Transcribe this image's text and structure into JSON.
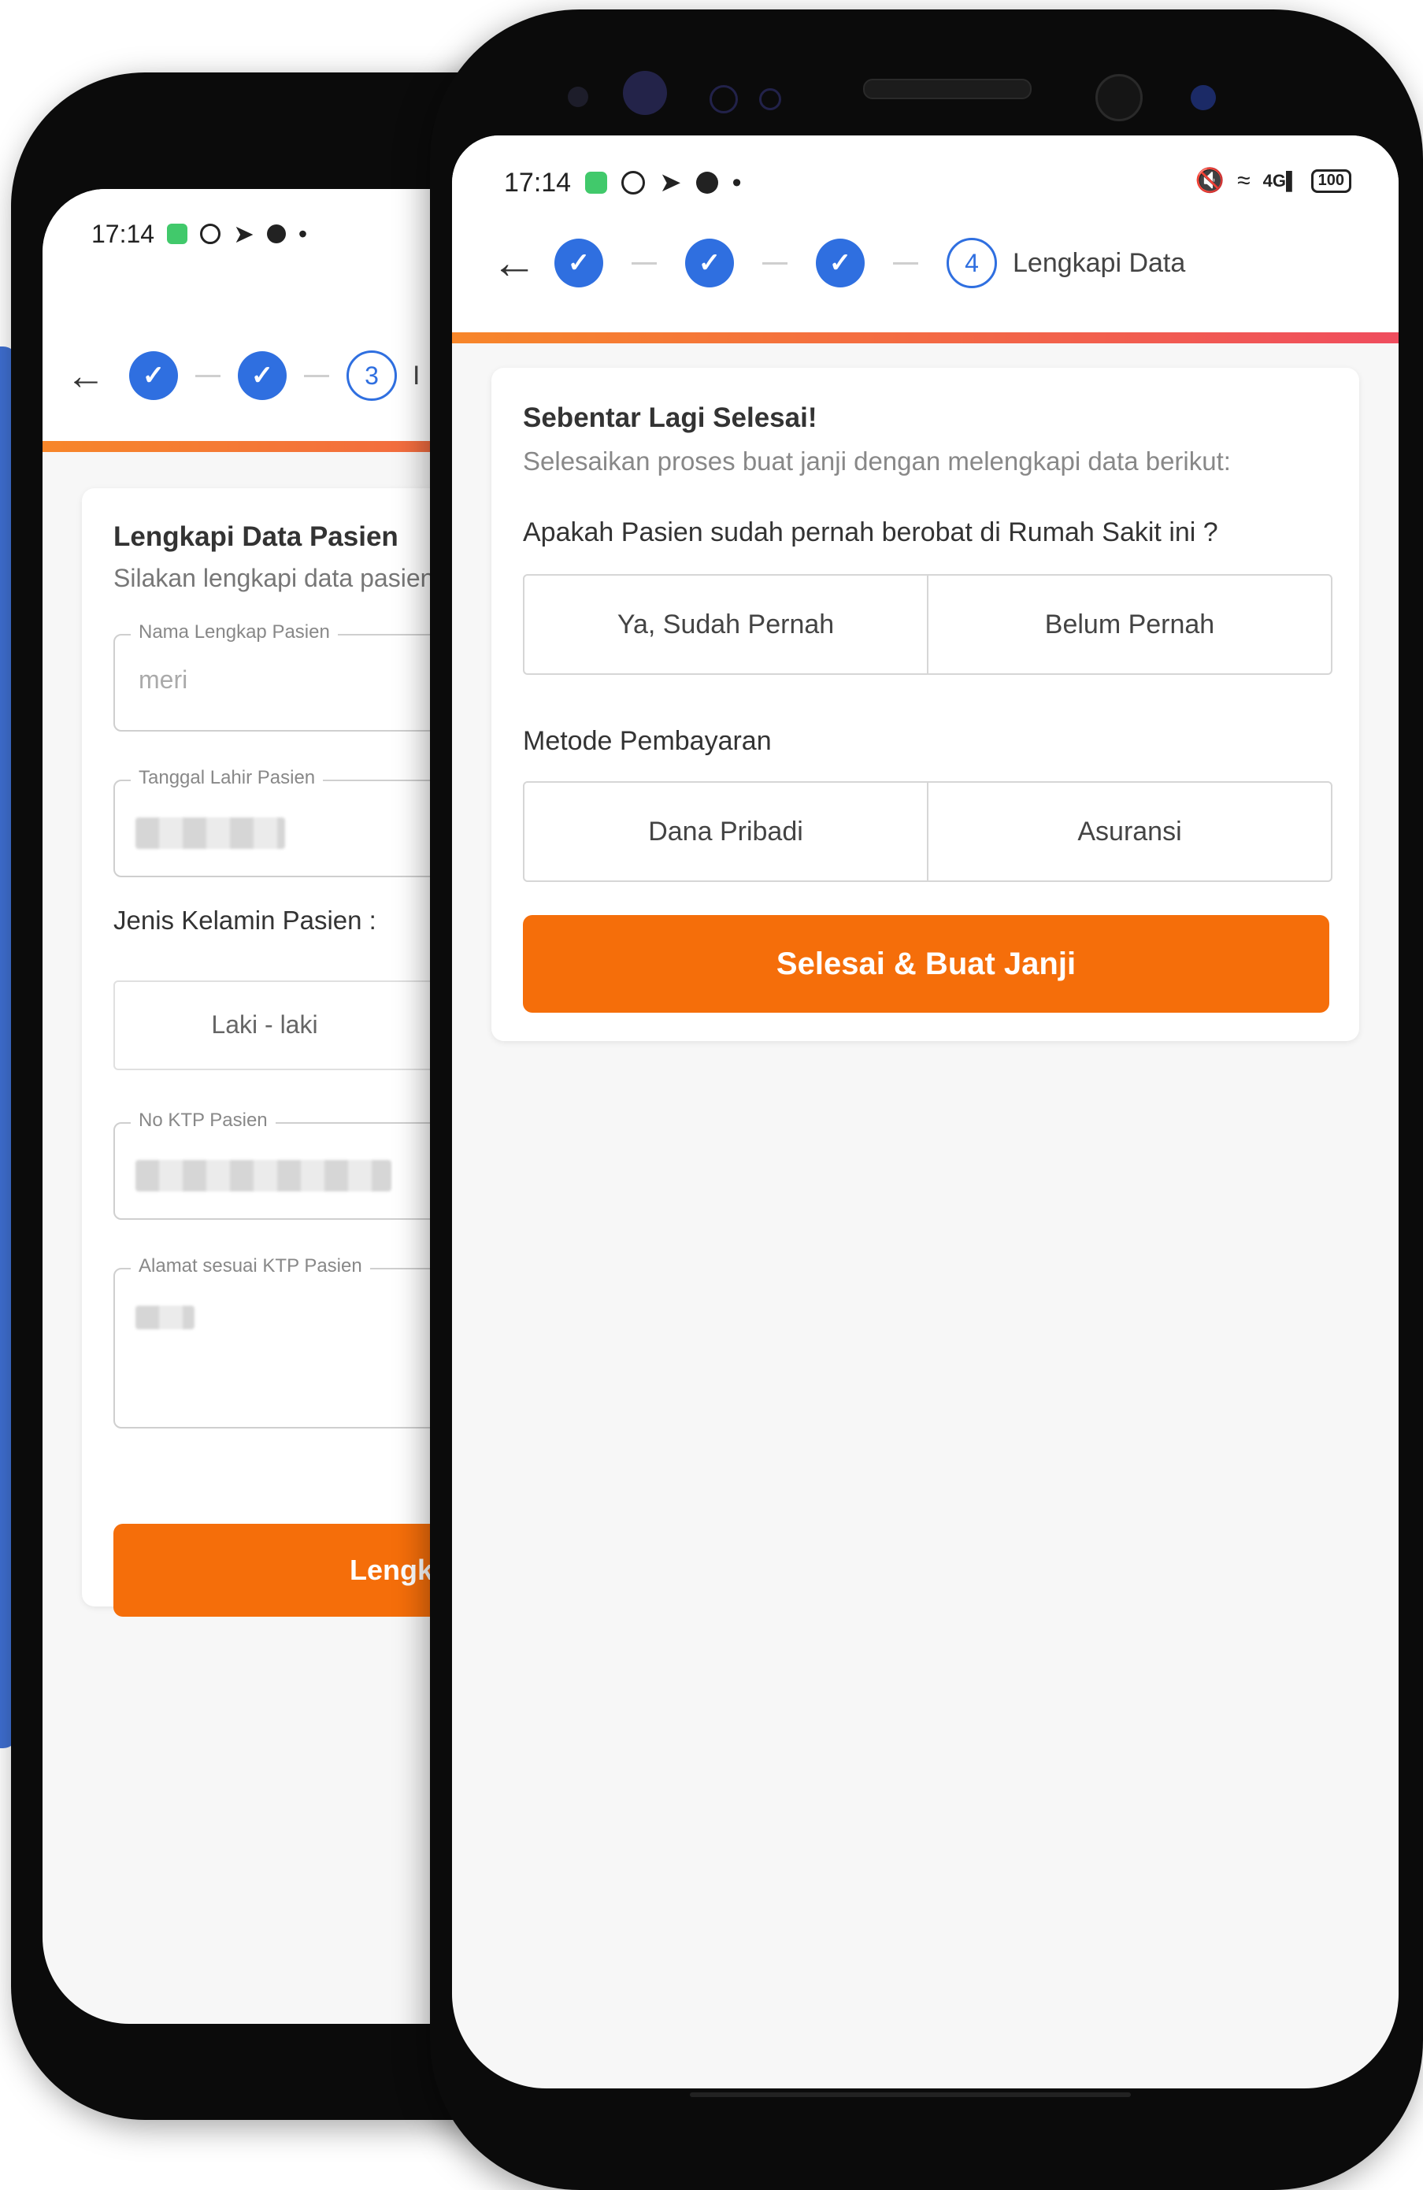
{
  "status_bar": {
    "time": "17:14",
    "battery": "100",
    "network": "4G"
  },
  "back_screen": {
    "status_time": "17:14",
    "current_step": "3",
    "current_step_label": "I",
    "card_title": "Lengkapi Data Pasien",
    "card_subtitle": "Silakan lengkapi data pasien",
    "fields": {
      "name_label": "Nama Lengkap Pasien",
      "name_value": "meri",
      "dob_label": "Tanggal Lahir Pasien",
      "ktp_label": "No KTP Pasien",
      "address_label": "Alamat sesuai KTP Pasien"
    },
    "gender_label": "Jenis Kelamin Pasien :",
    "gender_option": "Laki - laki",
    "button_label": "Lengka"
  },
  "front_screen": {
    "stepper": {
      "current_step": "4",
      "current_label": "Lengkapi Data"
    },
    "card": {
      "title": "Sebentar Lagi Selesai!",
      "subtitle": "Selesaikan proses buat janji dengan melengkapi data berikut:",
      "question": "Apakah Pasien sudah pernah berobat di Rumah Sakit ini ?",
      "option_yes": "Ya, Sudah Pernah",
      "option_no": "Belum Pernah",
      "payment_label": "Metode Pembayaran",
      "payment_personal": "Dana Pribadi",
      "payment_insurance": "Asuransi",
      "submit_label": "Selesai & Buat Janji"
    }
  },
  "colors": {
    "accent_orange": "#f56e0a",
    "step_blue": "#2f6fe0",
    "gradient_start": "#f7862a",
    "gradient_end": "#ef4d5e"
  }
}
